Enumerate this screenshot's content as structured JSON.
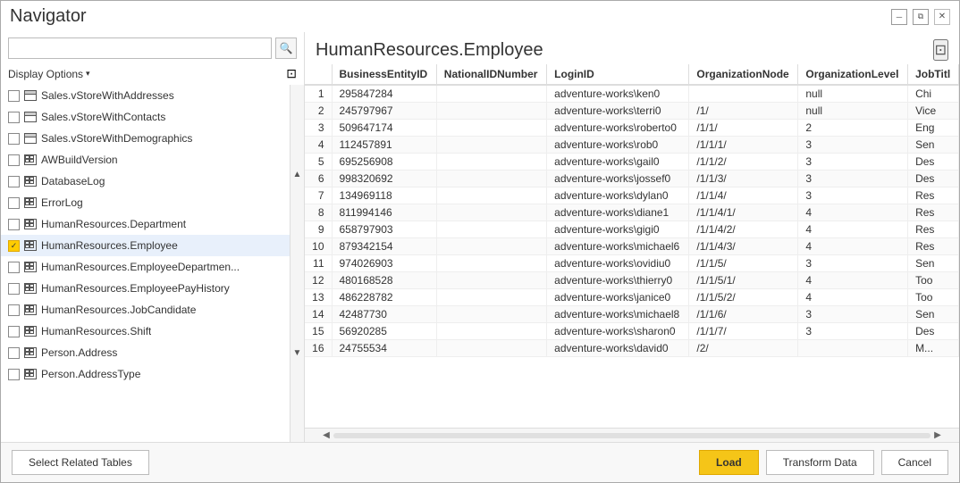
{
  "window": {
    "title": "Navigator",
    "controls": {
      "minimize": "🗕",
      "restore": "⧉",
      "close": "✕"
    }
  },
  "left_panel": {
    "search_placeholder": "",
    "display_options_label": "Display Options",
    "nav_items": [
      {
        "id": 0,
        "label": "Sales.vStoreWithAddresses",
        "type": "view",
        "checked": false,
        "selected": false
      },
      {
        "id": 1,
        "label": "Sales.vStoreWithContacts",
        "type": "view",
        "checked": false,
        "selected": false
      },
      {
        "id": 2,
        "label": "Sales.vStoreWithDemographics",
        "type": "view",
        "checked": false,
        "selected": false
      },
      {
        "id": 3,
        "label": "AWBuildVersion",
        "type": "table",
        "checked": false,
        "selected": false
      },
      {
        "id": 4,
        "label": "DatabaseLog",
        "type": "table",
        "checked": false,
        "selected": false
      },
      {
        "id": 5,
        "label": "ErrorLog",
        "type": "table",
        "checked": false,
        "selected": false
      },
      {
        "id": 6,
        "label": "HumanResources.Department",
        "type": "table",
        "checked": false,
        "selected": false
      },
      {
        "id": 7,
        "label": "HumanResources.Employee",
        "type": "table",
        "checked": true,
        "selected": true
      },
      {
        "id": 8,
        "label": "HumanResources.EmployeeDepartmen...",
        "type": "table",
        "checked": false,
        "selected": false
      },
      {
        "id": 9,
        "label": "HumanResources.EmployeePayHistory",
        "type": "table",
        "checked": false,
        "selected": false
      },
      {
        "id": 10,
        "label": "HumanResources.JobCandidate",
        "type": "table",
        "checked": false,
        "selected": false
      },
      {
        "id": 11,
        "label": "HumanResources.Shift",
        "type": "table",
        "checked": false,
        "selected": false
      },
      {
        "id": 12,
        "label": "Person.Address",
        "type": "table",
        "checked": false,
        "selected": false
      },
      {
        "id": 13,
        "label": "Person.AddressType",
        "type": "table",
        "checked": false,
        "selected": false
      }
    ]
  },
  "right_panel": {
    "title": "HumanResources.Employee",
    "columns": [
      "BusinessEntityID",
      "NationalIDNumber",
      "LoginID",
      "OrganizationNode",
      "OrganizationLevel",
      "JobTitl"
    ],
    "rows": [
      {
        "num": 1,
        "id": "295847284",
        "nid": "",
        "login": "adventure-works\\ken0",
        "orgnode": "",
        "orglevel": "null",
        "jobtitle": "Chi"
      },
      {
        "num": 2,
        "id": "245797967",
        "nid": "",
        "login": "adventure-works\\terri0",
        "orgnode": "/1/",
        "orglevel": "null",
        "jobtitle": "Vice"
      },
      {
        "num": 3,
        "id": "509647174",
        "nid": "",
        "login": "adventure-works\\roberto0",
        "orgnode": "/1/1/",
        "orglevel": "2",
        "jobtitle": "Eng"
      },
      {
        "num": 4,
        "id": "112457891",
        "nid": "",
        "login": "adventure-works\\rob0",
        "orgnode": "/1/1/1/",
        "orglevel": "3",
        "jobtitle": "Sen"
      },
      {
        "num": 5,
        "id": "695256908",
        "nid": "",
        "login": "adventure-works\\gail0",
        "orgnode": "/1/1/2/",
        "orglevel": "3",
        "jobtitle": "Des"
      },
      {
        "num": 6,
        "id": "998320692",
        "nid": "",
        "login": "adventure-works\\jossef0",
        "orgnode": "/1/1/3/",
        "orglevel": "3",
        "jobtitle": "Des"
      },
      {
        "num": 7,
        "id": "134969118",
        "nid": "",
        "login": "adventure-works\\dylan0",
        "orgnode": "/1/1/4/",
        "orglevel": "3",
        "jobtitle": "Res"
      },
      {
        "num": 8,
        "id": "811994146",
        "nid": "",
        "login": "adventure-works\\diane1",
        "orgnode": "/1/1/4/1/",
        "orglevel": "4",
        "jobtitle": "Res"
      },
      {
        "num": 9,
        "id": "658797903",
        "nid": "",
        "login": "adventure-works\\gigi0",
        "orgnode": "/1/1/4/2/",
        "orglevel": "4",
        "jobtitle": "Res"
      },
      {
        "num": 10,
        "id": "879342154",
        "nid": "",
        "login": "adventure-works\\michael6",
        "orgnode": "/1/1/4/3/",
        "orglevel": "4",
        "jobtitle": "Res"
      },
      {
        "num": 11,
        "id": "974026903",
        "nid": "",
        "login": "adventure-works\\ovidiu0",
        "orgnode": "/1/1/5/",
        "orglevel": "3",
        "jobtitle": "Sen"
      },
      {
        "num": 12,
        "id": "480168528",
        "nid": "",
        "login": "adventure-works\\thierry0",
        "orgnode": "/1/1/5/1/",
        "orglevel": "4",
        "jobtitle": "Too"
      },
      {
        "num": 13,
        "id": "486228782",
        "nid": "",
        "login": "adventure-works\\janice0",
        "orgnode": "/1/1/5/2/",
        "orglevel": "4",
        "jobtitle": "Too"
      },
      {
        "num": 14,
        "id": "42487730",
        "nid": "",
        "login": "adventure-works\\michael8",
        "orgnode": "/1/1/6/",
        "orglevel": "3",
        "jobtitle": "Sen"
      },
      {
        "num": 15,
        "id": "56920285",
        "nid": "",
        "login": "adventure-works\\sharon0",
        "orgnode": "/1/1/7/",
        "orglevel": "3",
        "jobtitle": "Des"
      },
      {
        "num": 16,
        "id": "24755534",
        "nid": "",
        "login": "adventure-works\\david0",
        "orgnode": "/2/",
        "orglevel": "",
        "jobtitle": "M..."
      }
    ]
  },
  "footer": {
    "select_related_label": "Select Related Tables",
    "load_label": "Load",
    "transform_label": "Transform Data",
    "cancel_label": "Cancel"
  }
}
